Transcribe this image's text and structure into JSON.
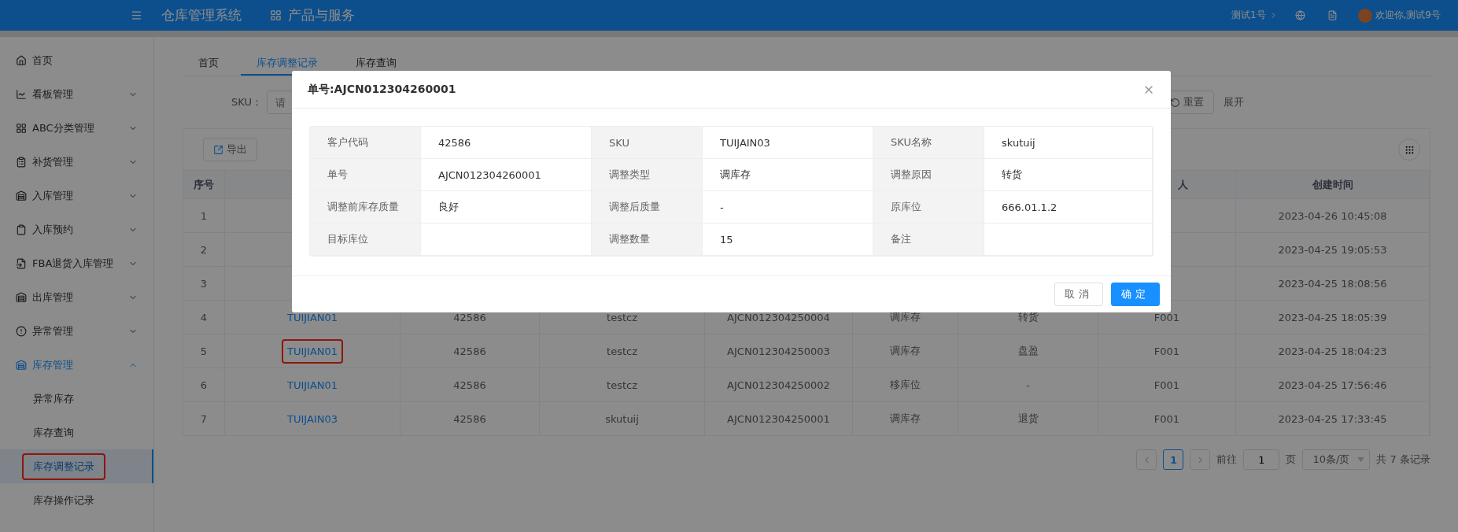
{
  "header": {
    "title": "仓库管理系统",
    "product_menu": "产品与服务",
    "org": "测试1号",
    "welcome": "欢迎你,测试9号"
  },
  "sidebar": {
    "items": [
      {
        "label": "首页",
        "selected": false
      },
      {
        "label": "看板管理",
        "expanded": false,
        "selected": false
      },
      {
        "label": "ABC分类管理",
        "expanded": false,
        "selected": false
      },
      {
        "label": "补货管理",
        "expanded": false,
        "selected": false
      },
      {
        "label": "入库管理",
        "expanded": false,
        "selected": false
      },
      {
        "label": "入库预约",
        "expanded": false,
        "selected": false
      },
      {
        "label": "FBA退货入库管理",
        "expanded": false,
        "selected": false
      },
      {
        "label": "出库管理",
        "expanded": false,
        "selected": false
      },
      {
        "label": "异常管理",
        "expanded": false,
        "selected": false
      },
      {
        "label": "库存管理",
        "expanded": true,
        "selected": true,
        "children": [
          {
            "label": "异常库存",
            "selected": false,
            "annotated": false
          },
          {
            "label": "库存查询",
            "selected": false,
            "annotated": false
          },
          {
            "label": "库存调整记录",
            "selected": true,
            "annotated": true
          },
          {
            "label": "库存操作记录",
            "selected": false,
            "annotated": false
          }
        ]
      }
    ]
  },
  "tabs": [
    {
      "label": "首页",
      "selected": false
    },
    {
      "label": "库存调整记录",
      "selected": true
    },
    {
      "label": "库存查询",
      "selected": false
    }
  ],
  "filters": {
    "sku_label": "SKU：",
    "sku_placeholder": "请",
    "reset": "重置",
    "expand": "展开"
  },
  "toolbar": {
    "export": "导出"
  },
  "table": {
    "header": {
      "no": "序号",
      "operator": "人",
      "created": "创建时间"
    },
    "rows": [
      {
        "no": "1",
        "created": "2023-04-26 10:45:08"
      },
      {
        "no": "2",
        "created": "2023-04-25 19:05:53"
      },
      {
        "no": "3",
        "created": "2023-04-25 18:08:56"
      },
      {
        "no": "4",
        "sku": "TUIJIAN01",
        "annotated": false,
        "customer": "42586",
        "sku_name": "testcz",
        "order_no": "AJCN012304250004",
        "type": "调库存",
        "reason": "转货",
        "operator": "F001",
        "created": "2023-04-25 18:05:39"
      },
      {
        "no": "5",
        "sku": "TUIJIAN01",
        "annotated": true,
        "customer": "42586",
        "sku_name": "testcz",
        "order_no": "AJCN012304250003",
        "type": "调库存",
        "reason": "盘盈",
        "operator": "F001",
        "created": "2023-04-25 18:04:23"
      },
      {
        "no": "6",
        "sku": "TUIJIAN01",
        "annotated": false,
        "customer": "42586",
        "sku_name": "testcz",
        "order_no": "AJCN012304250002",
        "type": "移库位",
        "reason": "-",
        "operator": "F001",
        "created": "2023-04-25 17:56:46"
      },
      {
        "no": "7",
        "sku": "TUIJAIN03",
        "annotated": false,
        "customer": "42586",
        "sku_name": "skutuij",
        "order_no": "AJCN012304250001",
        "type": "调库存",
        "reason": "退货",
        "operator": "F001",
        "created": "2023-04-25 17:33:45"
      }
    ]
  },
  "pagination": {
    "pages": [
      {
        "label": "1",
        "selected": true
      }
    ],
    "goto_label": "前往",
    "goto_value": "1",
    "page_unit": "页",
    "page_size": "10条/页",
    "total": "共 7 条记录"
  },
  "modal": {
    "title": "单号:AJCN012304260001",
    "fields": [
      {
        "label": "客户代码",
        "value": "42586"
      },
      {
        "label": "SKU",
        "value": "TUIJAIN03"
      },
      {
        "label": "SKU名称",
        "value": "skutuij"
      },
      {
        "label": "单号",
        "value": "AJCN012304260001"
      },
      {
        "label": "调整类型",
        "value": "调库存"
      },
      {
        "label": "调整原因",
        "value": "转货"
      },
      {
        "label": "调整前库存质量",
        "value": "良好"
      },
      {
        "label": "调整后质量",
        "value": "-"
      },
      {
        "label": "原库位",
        "value": "666.01.1.2"
      },
      {
        "label": "目标库位"
      },
      {
        "label": "调整数量",
        "value": "15"
      },
      {
        "label": "备注"
      }
    ],
    "cancel": "取消",
    "confirm": "确定"
  }
}
